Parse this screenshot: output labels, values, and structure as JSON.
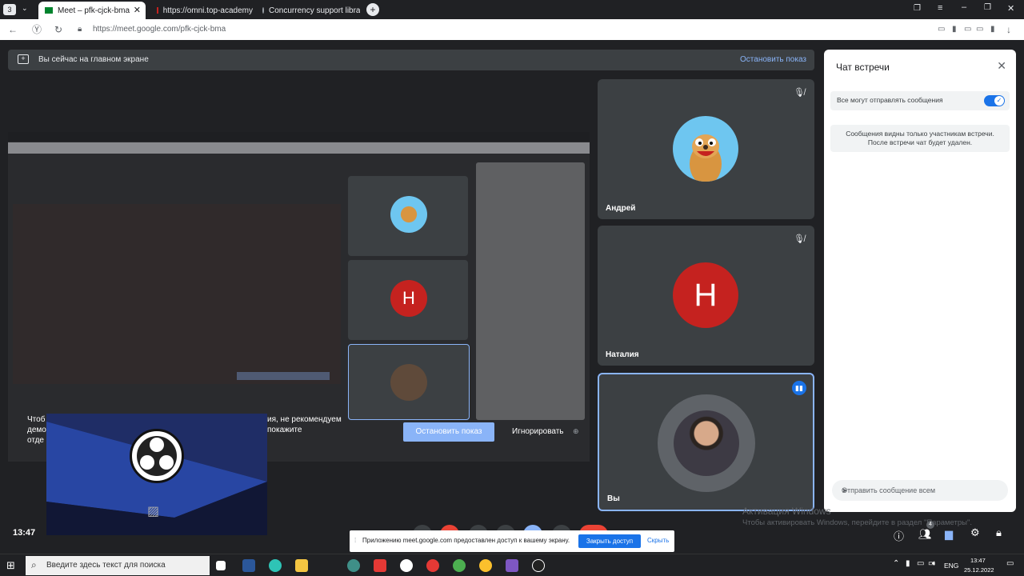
{
  "browser": {
    "tabs": [
      {
        "label": "Meet – pfk-cjck-bma",
        "active": true
      },
      {
        "label": "https://omni.top-academy",
        "active": false
      },
      {
        "label": "Concurrency support libra",
        "active": false
      }
    ],
    "url": "https://meet.google.com/pfk-cjck-bma"
  },
  "meet": {
    "banner_text": "Вы сейчас на главном экране",
    "stop_sharing": "Остановить показ",
    "participants": [
      {
        "name": "Андрей",
        "avatar_type": "cartoon-meerkat",
        "muted": true
      },
      {
        "name": "Наталия",
        "initial": "Н",
        "avatar_color": "#c5221f",
        "muted": true
      },
      {
        "name": "Вы",
        "avatar_type": "photo",
        "speaking": true
      }
    ],
    "overlay_buttons": {
      "stop": "Остановить показ",
      "ignore": "Игнорировать"
    },
    "overlay_left": {
      "line1": "Чтоб",
      "line2": "демо",
      "line3": "отде"
    },
    "overlay_right": {
      "line1": "ия, не рекомендуем",
      "line2": "покажите"
    },
    "time": "13:47"
  },
  "chat": {
    "title": "Чат встречи",
    "toggle_label": "Все могут отправлять сообщения",
    "note_line1": "Сообщения видны только участникам встречи.",
    "note_line2": "После встречи чат будет удален.",
    "input_placeholder": "Отправить сообщение всем"
  },
  "activation": {
    "title": "Активация Windows",
    "sub": "Чтобы активировать Windows, перейдите в раздел \"Параметры\"."
  },
  "sharebar": {
    "message": "Приложению meet.google.com предоставлен доступ к вашему экрану.",
    "close_access": "Закрыть доступ",
    "hide": "Скрыть"
  },
  "taskbar": {
    "search_placeholder": "Введите здесь текст для поиска",
    "lang": "ENG",
    "clock_time": "13:47",
    "clock_date": "25.12.2022"
  },
  "colors": {
    "accent": "#1a73e8",
    "speaking_border": "#8ab4f8"
  }
}
